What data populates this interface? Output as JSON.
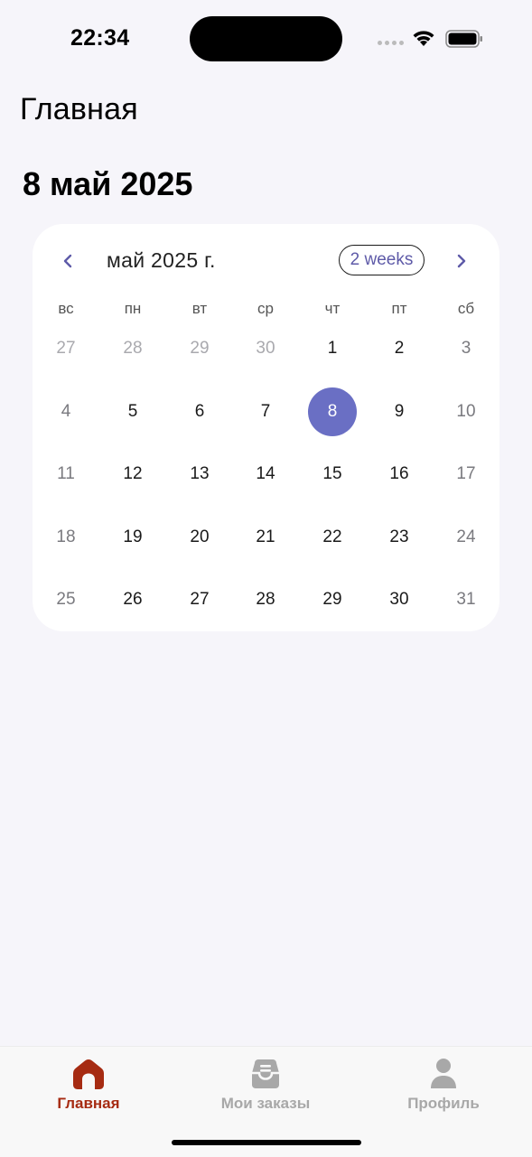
{
  "status_bar": {
    "time": "22:34"
  },
  "header": {
    "title": "Главная",
    "selected_date": "8 май 2025"
  },
  "calendar": {
    "month_label": "май 2025 г.",
    "format_button": "2 weeks",
    "weekdays": [
      "вс",
      "пн",
      "вт",
      "ср",
      "чт",
      "пт",
      "сб"
    ],
    "selected_day": "8",
    "weeks": [
      [
        "27",
        "28",
        "29",
        "30",
        "1",
        "2",
        "3"
      ],
      [
        "4",
        "5",
        "6",
        "7",
        "8",
        "9",
        "10"
      ],
      [
        "11",
        "12",
        "13",
        "14",
        "15",
        "16",
        "17"
      ],
      [
        "18",
        "19",
        "20",
        "21",
        "22",
        "23",
        "24"
      ],
      [
        "25",
        "26",
        "27",
        "28",
        "29",
        "30",
        "31"
      ]
    ],
    "outside_month_cells": [
      [
        0,
        0
      ],
      [
        0,
        1
      ],
      [
        0,
        2
      ],
      [
        0,
        3
      ]
    ],
    "accent_color": "#6A6FC4",
    "arrow_color": "#5E5AA8"
  },
  "tab_bar": {
    "tabs": [
      {
        "label": "Главная",
        "icon": "home-icon",
        "active": true
      },
      {
        "label": "Мои заказы",
        "icon": "orders-icon",
        "active": false
      },
      {
        "label": "Профиль",
        "icon": "profile-icon",
        "active": false
      }
    ],
    "active_color": "#A62B12",
    "inactive_color": "#A8A8A8"
  }
}
